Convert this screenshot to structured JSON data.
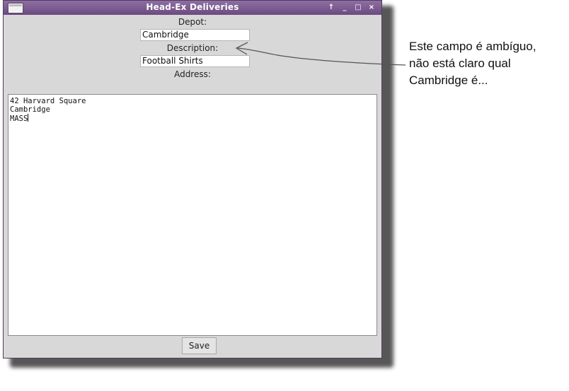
{
  "window": {
    "title": "Head-Ex Deliveries",
    "buttons": [
      "↑",
      "_",
      "□",
      "×"
    ]
  },
  "form": {
    "depot_label": "Depot:",
    "depot_value": "Cambridge",
    "description_label": "Description:",
    "description_value": "Football Shirts",
    "address_label": "Address:"
  },
  "address_lines": [
    "42 Harvard Square",
    "Cambridge",
    "MASS"
  ],
  "footer": {
    "save_label": "Save"
  },
  "annotation": {
    "lines": [
      "Este campo é ambíguo,",
      "não está claro qual",
      "Cambridge é..."
    ]
  },
  "colors": {
    "titlebar": "#7a5a90",
    "window_bg": "#d8d8d8"
  }
}
